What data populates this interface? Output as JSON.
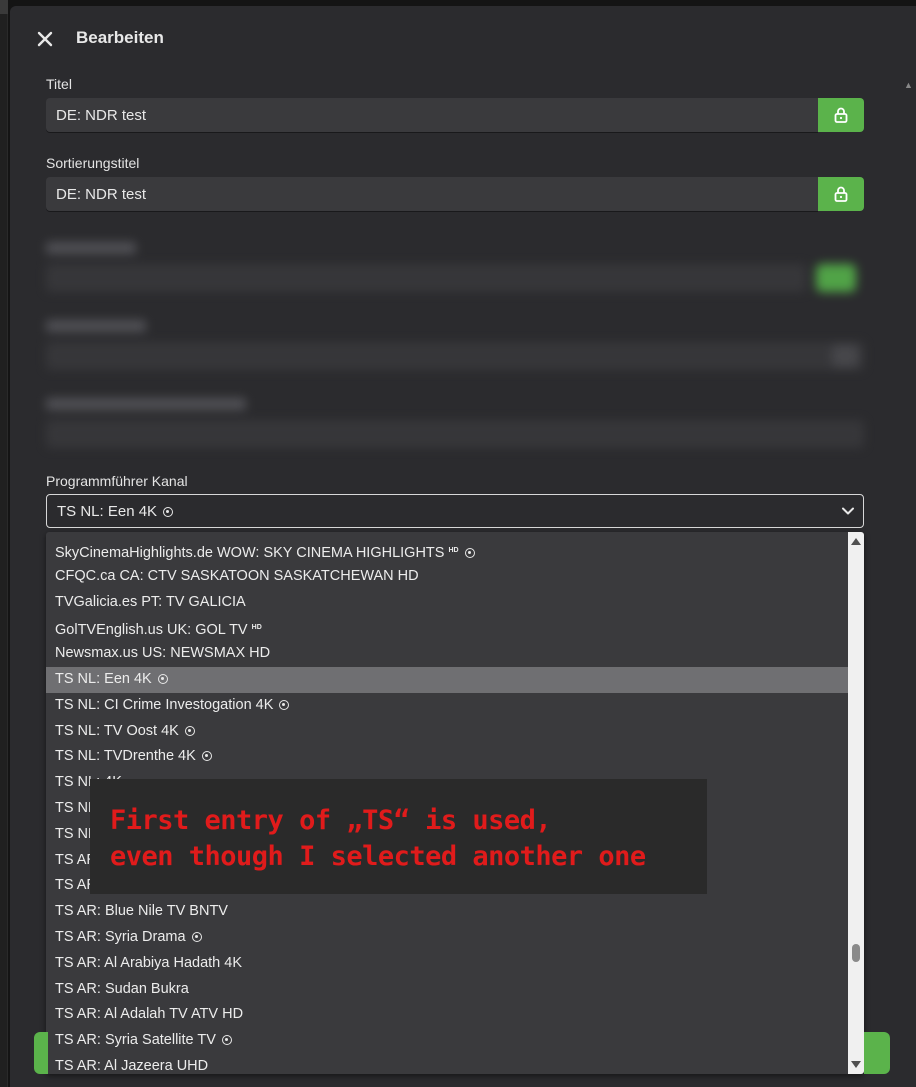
{
  "dialog": {
    "title": "Bearbeiten",
    "close_icon": "close-icon"
  },
  "fields": {
    "title": {
      "label": "Titel",
      "value": "DE: NDR test",
      "lock_icon": "lock-open-icon"
    },
    "sort_title": {
      "label": "Sortierungstitel",
      "value": "DE: NDR test",
      "lock_icon": "lock-open-icon"
    }
  },
  "epg": {
    "label": "Programmführer Kanal",
    "selected_value": "TS NL: Een 4K",
    "chevron_icon": "chevron-down-icon"
  },
  "dropdown": {
    "items": [
      {
        "label": "SkyCinemaHighlights.de WOW: SKY CINEMA HIGHLIGHTS ",
        "hd": "HD",
        "radio": true
      },
      {
        "label": "CFQC.ca CA: CTV SASKATOON SASKATCHEWAN HD"
      },
      {
        "label": "TVGalicia.es PT: TV GALICIA"
      },
      {
        "label": "GolTVEnglish.us UK: GOL TV ",
        "hd": "HD"
      },
      {
        "label": "Newsmax.us US: NEWSMAX HD"
      },
      {
        "label": "TS NL: Een 4K ",
        "radio": true,
        "selected": true
      },
      {
        "label": "TS NL: CI Crime Investogation 4K ",
        "radio": true
      },
      {
        "label": "TS NL: TV Oost 4K ",
        "radio": true
      },
      {
        "label": "TS NL: TVDrenthe 4K ",
        "radio": true
      },
      {
        "label": "TS NL: 4K"
      },
      {
        "label": "TS NL"
      },
      {
        "label": "TS NL"
      },
      {
        "label": "TS AR"
      },
      {
        "label": "TS AR"
      },
      {
        "label": "TS AR: Blue Nile TV BNTV"
      },
      {
        "label": "TS AR: Syria Drama ",
        "radio": true
      },
      {
        "label": "TS AR: Al Arabiya Hadath 4K"
      },
      {
        "label": "TS AR: Sudan Bukra"
      },
      {
        "label": "TS AR: Al Adalah TV ATV HD"
      },
      {
        "label": "TS AR: Syria Satellite TV ",
        "radio": true
      },
      {
        "label": "TS AR: Al Jazeera UHD"
      }
    ]
  },
  "annotation": {
    "line1": "First entry of „TS“ is used,",
    "line2": "even though I selected another one",
    "color": "#e01b1b"
  },
  "colors": {
    "accent_green": "#5bb34b",
    "dialog_bg": "#2b2b2e",
    "field_bg": "#3a3a3d"
  }
}
